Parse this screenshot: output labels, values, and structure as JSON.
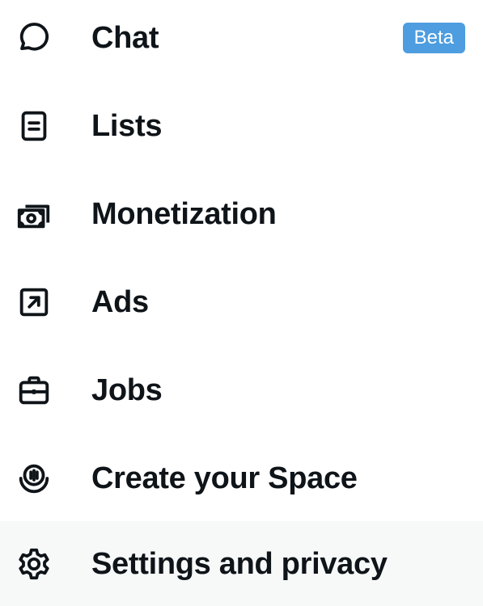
{
  "menu": {
    "items": [
      {
        "label": "Chat",
        "icon": "chat-bubble-icon",
        "badge": "Beta"
      },
      {
        "label": "Lists",
        "icon": "list-document-icon"
      },
      {
        "label": "Monetization",
        "icon": "money-icon"
      },
      {
        "label": "Ads",
        "icon": "external-arrow-icon"
      },
      {
        "label": "Jobs",
        "icon": "briefcase-icon"
      },
      {
        "label": "Create your Space",
        "icon": "microphone-icon"
      },
      {
        "label": "Settings and privacy",
        "icon": "gear-icon",
        "highlighted": true
      }
    ]
  },
  "colors": {
    "text": "#0f1419",
    "badge_bg": "#4d9de0",
    "hover_bg": "#f7f9f9"
  }
}
